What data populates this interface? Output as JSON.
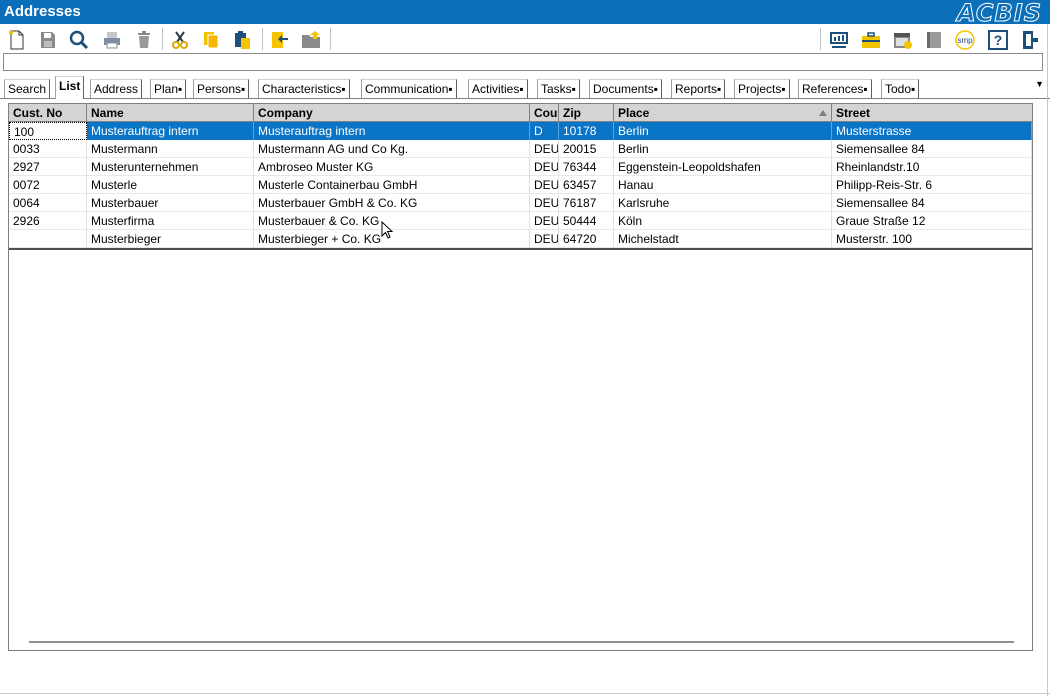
{
  "window": {
    "title": "Addresses",
    "logo_text": "ACBIS"
  },
  "toolbar": {
    "icons": [
      "new-document-icon",
      "save-icon",
      "search-icon",
      "print-icon",
      "delete-icon",
      "cut-icon",
      "copy-icon",
      "paste-icon",
      "import-icon",
      "open-folder-icon",
      "monitor-icon",
      "briefcase-icon",
      "calendar-check-icon",
      "book-icon",
      "smp-icon",
      "help-icon",
      "exit-icon"
    ],
    "smp_label": "smp",
    "help_label": "?"
  },
  "command_line": {
    "value": ""
  },
  "tabs": [
    "Search",
    "List",
    "Address",
    "Plan▪",
    "Persons▪",
    "Characteristics▪",
    "Communication▪",
    "Activities▪",
    "Tasks▪",
    "Documents▪",
    "Reports▪",
    "Projects▪",
    "References▪",
    "Todo▪"
  ],
  "active_tab": "List",
  "table": {
    "columns": [
      "Cust. No",
      "Name",
      "Company",
      "Cou",
      "Zip",
      "Place",
      "Street"
    ],
    "sorted_column": "Place",
    "rows": [
      {
        "cust_no": "100",
        "name": "Musterauftrag intern",
        "company": "Musterauftrag intern",
        "country": "D",
        "zip": "10178",
        "place": "Berlin",
        "street": "Musterstrasse",
        "selected": true
      },
      {
        "cust_no": "0033",
        "name": "Mustermann",
        "company": "Mustermann AG und Co Kg.",
        "country": "DEU",
        "zip": "20015",
        "place": "Berlin",
        "street": "Siemensallee 84",
        "selected": false
      },
      {
        "cust_no": "2927",
        "name": "Musterunternehmen",
        "company": "Ambroseo Muster KG",
        "country": "DEU",
        "zip": "76344",
        "place": "Eggenstein-Leopoldshafen",
        "street": "Rheinlandstr.10",
        "selected": false
      },
      {
        "cust_no": "0072",
        "name": "Musterle",
        "company": "Musterle Containerbau GmbH",
        "country": "DEU",
        "zip": "63457",
        "place": "Hanau",
        "street": "Philipp-Reis-Str. 6",
        "selected": false
      },
      {
        "cust_no": "0064",
        "name": "Musterbauer",
        "company": "Musterbauer GmbH & Co. KG",
        "country": "DEU",
        "zip": "76187",
        "place": "Karlsruhe",
        "street": "Siemensallee 84",
        "selected": false
      },
      {
        "cust_no": "2926",
        "name": "Musterfirma",
        "company": "Musterbauer & Co. KG",
        "country": "DEU",
        "zip": "50444",
        "place": "Köln",
        "street": "Graue Straße 12",
        "selected": false
      },
      {
        "cust_no": "",
        "name": "Musterbieger",
        "company": "Musterbieger + Co. KG",
        "country": "DEU",
        "zip": "64720",
        "place": "Michelstadt",
        "street": "Musterstr. 100",
        "selected": false
      }
    ]
  },
  "colors": {
    "title_bar": "#0a6fb8",
    "selection": "#0a74c7",
    "header_bg": "#d4d4d4"
  }
}
